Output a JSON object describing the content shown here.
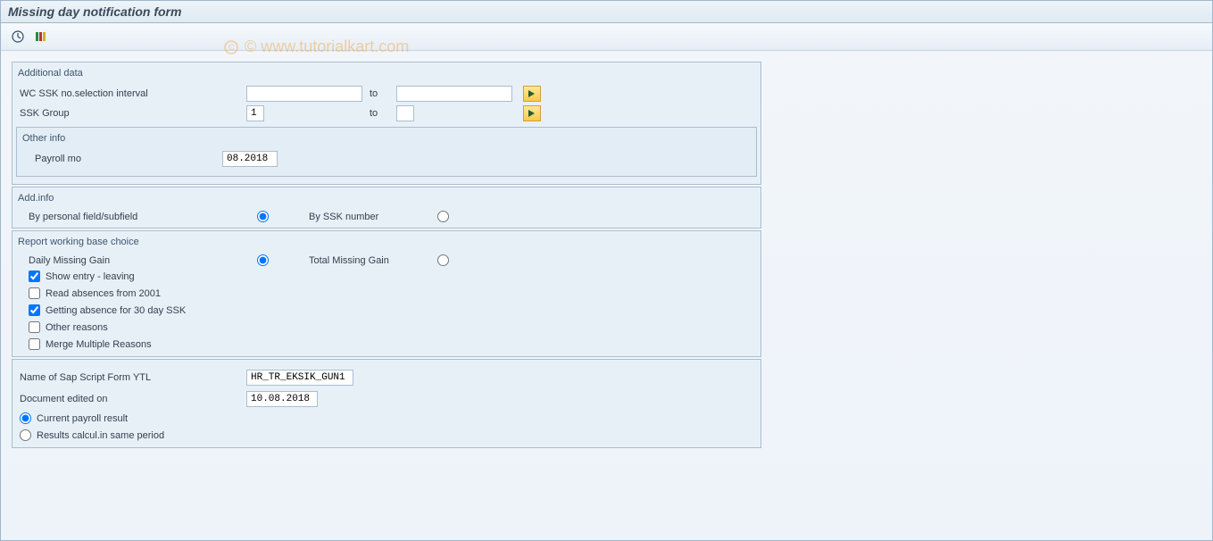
{
  "title": "Missing day notification form",
  "watermark": "© www.tutorialkart.com",
  "additional_data": {
    "group_label": "Additional data",
    "wc_ssk": {
      "label": "WC SSK no.selection interval",
      "from": "",
      "to_label": "to",
      "to": ""
    },
    "ssk_group": {
      "label": "SSK Group",
      "from": "1",
      "to_label": "to",
      "to": ""
    },
    "other_info": {
      "group_label": "Other info",
      "payroll_mo_label": "Payroll mo",
      "payroll_mo_value": "08.2018"
    }
  },
  "add_info": {
    "group_label": "Add.info",
    "by_personal_label": "By personal field/subfield",
    "by_ssk_label": "By SSK number",
    "selected": "personal"
  },
  "report_choice": {
    "group_label": "Report working base choice",
    "daily_label": "Daily Missing Gain",
    "total_label": "Total Missing Gain",
    "selected": "daily",
    "checks": {
      "show_entry": {
        "label": "Show entry - leaving",
        "checked": true
      },
      "read_absences": {
        "label": "Read absences from 2001",
        "checked": false
      },
      "getting_absence": {
        "label": "Getting absence for 30 day SSK",
        "checked": true
      },
      "other_reasons": {
        "label": "Other reasons",
        "checked": false
      },
      "merge_multiple": {
        "label": "Merge Multiple Reasons",
        "checked": false
      }
    }
  },
  "bottom": {
    "form_name_label": "Name of Sap Script Form YTL",
    "form_name_value": "HR_TR_EKSIK_GUN1",
    "doc_edited_label": "Document edited on",
    "doc_edited_value": "10.08.2018",
    "current_payroll_label": "Current payroll result",
    "results_calc_label": "Results calcul.in same period",
    "selected": "current"
  },
  "icons": {
    "execute": "execute-icon",
    "variant": "variant-icon",
    "arrow": "arrow-right-icon"
  }
}
